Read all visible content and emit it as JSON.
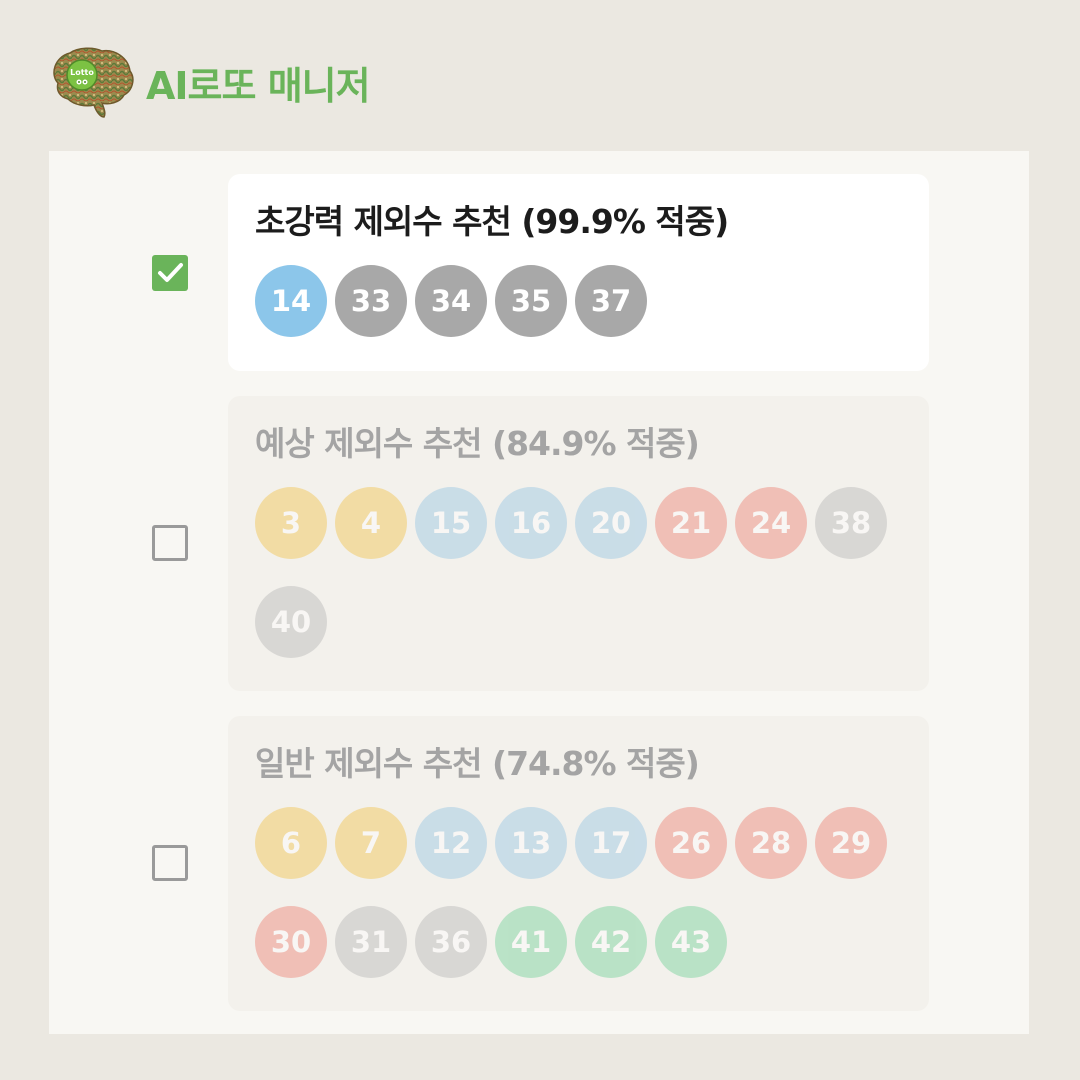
{
  "header": {
    "title": "AI로또 매니저",
    "logo_text": "Lotto"
  },
  "options": [
    {
      "title": "초강력 제외수 추천 (99.9% 적중)",
      "checked": true,
      "numbers": [
        {
          "value": "14",
          "color": "blue"
        },
        {
          "value": "33",
          "color": "gray"
        },
        {
          "value": "34",
          "color": "gray"
        },
        {
          "value": "35",
          "color": "gray"
        },
        {
          "value": "37",
          "color": "gray"
        }
      ]
    },
    {
      "title": "예상 제외수 추천 (84.9% 적중)",
      "checked": false,
      "numbers": [
        {
          "value": "3",
          "color": "yellow"
        },
        {
          "value": "4",
          "color": "yellow"
        },
        {
          "value": "15",
          "color": "blue"
        },
        {
          "value": "16",
          "color": "blue"
        },
        {
          "value": "20",
          "color": "blue"
        },
        {
          "value": "21",
          "color": "red"
        },
        {
          "value": "24",
          "color": "red"
        },
        {
          "value": "38",
          "color": "gray"
        },
        {
          "value": "40",
          "color": "gray"
        }
      ]
    },
    {
      "title": "일반 제외수 추천 (74.8% 적중)",
      "checked": false,
      "numbers": [
        {
          "value": "6",
          "color": "yellow"
        },
        {
          "value": "7",
          "color": "yellow"
        },
        {
          "value": "12",
          "color": "blue"
        },
        {
          "value": "13",
          "color": "blue"
        },
        {
          "value": "17",
          "color": "blue"
        },
        {
          "value": "26",
          "color": "red"
        },
        {
          "value": "28",
          "color": "red"
        },
        {
          "value": "29",
          "color": "red"
        },
        {
          "value": "30",
          "color": "red"
        },
        {
          "value": "31",
          "color": "gray"
        },
        {
          "value": "36",
          "color": "gray"
        },
        {
          "value": "41",
          "color": "green"
        },
        {
          "value": "42",
          "color": "green"
        },
        {
          "value": "43",
          "color": "green"
        }
      ]
    }
  ],
  "colors": {
    "accent": "#6ab45a",
    "yellow": "#f1c043",
    "blue": "#82c2e8",
    "red": "#ee7b6d",
    "gray": "#a8a8a8",
    "green": "#6bcf94"
  },
  "icons": {
    "logo": "brain-icon",
    "checked": "checkbox-checked-icon",
    "unchecked": "checkbox-unchecked-icon"
  }
}
